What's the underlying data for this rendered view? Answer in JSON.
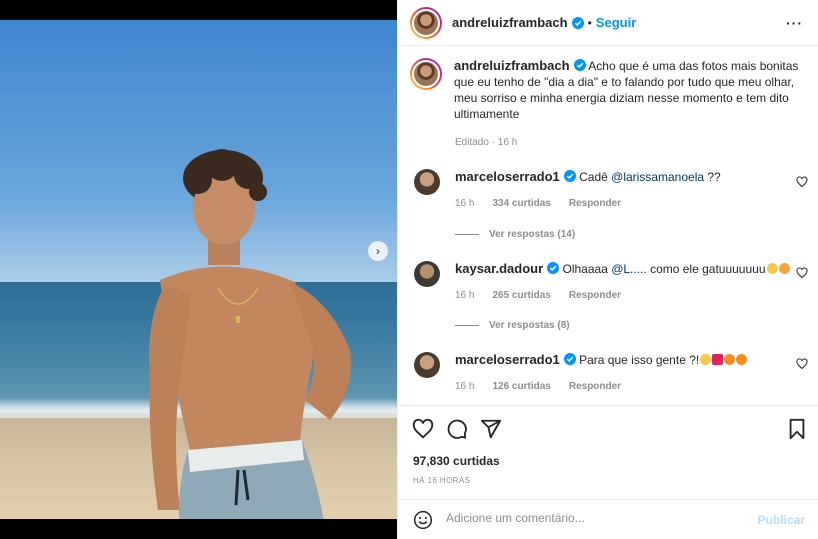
{
  "post": {
    "username": "andreluizframbach",
    "follow_label": "Seguir",
    "separator": "•",
    "caption": "Acho que é uma das fotos mais bonitas que eu tenho de \"dia a dia\" e to falando por tudo que meu olhar, meu sorriso e minha energia diziam nesse momento e tem dito ultimamente",
    "caption_meta": "Editado · 16 h",
    "likes": "97,830 curtidas",
    "time_ago": "HÁ 16 HORAS"
  },
  "comments": [
    {
      "username": "marceloserrado1",
      "pre": "Cadê ",
      "mention": "@larissamanoela",
      "post": " ??",
      "time": "16 h",
      "likes": "334 curtidas",
      "reply": "Responder",
      "view_replies": "Ver respostas (14)"
    },
    {
      "username": "kaysar.dadour",
      "pre": "Olhaaaa ",
      "mention": "@L.....",
      "post": " como ele gatuuuuuuu",
      "time": "16 h",
      "likes": "265 curtidas",
      "reply": "Responder",
      "view_replies": "Ver respostas (8)"
    },
    {
      "username": "marceloserrado1",
      "pre": "Para que isso gente ?!",
      "mention": "",
      "post": "",
      "time": "16 h",
      "likes": "126 curtidas",
      "reply": "Responder"
    }
  ],
  "composer": {
    "placeholder": "Adicione um comentário...",
    "publish_label": "Publicar"
  },
  "icons": {
    "like": "heart-icon",
    "comment": "comment-icon",
    "share": "share-icon",
    "save": "bookmark-icon",
    "emoji": "emoji-icon",
    "more": "more-options-icon",
    "verified": "verified-badge-icon",
    "next": "chevron-right-icon"
  },
  "colors": {
    "accent": "#0095f6",
    "muted": "#8e8e8e",
    "publish_disabled": "#b2dffc",
    "heart_emoji": "#e0245e"
  }
}
